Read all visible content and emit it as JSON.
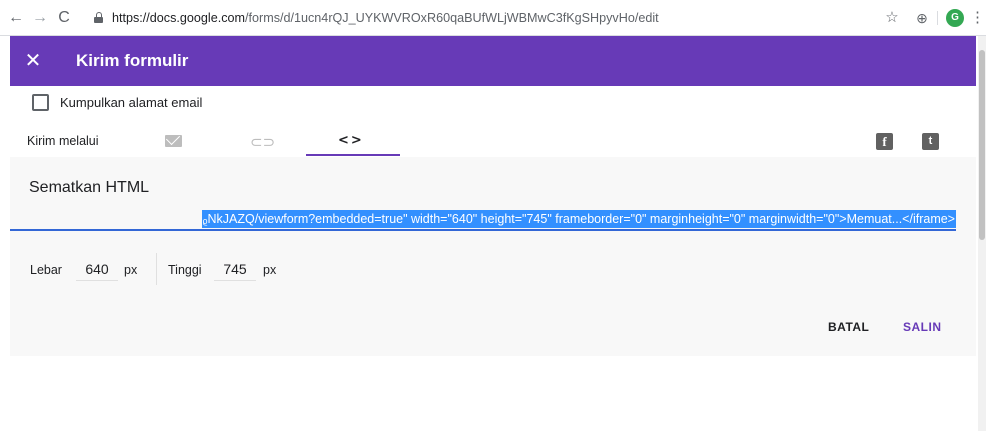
{
  "browser": {
    "url_host": "https://docs.google.com",
    "url_path": "/forms/d/1ucn4rQJ_UYKWVROxR60qaBUfWLjWBMwC3fKgSHpyvHo/edit",
    "nav_back": "←",
    "nav_forward": "→",
    "nav_reload": "C",
    "bookmark_star": "☆",
    "extension_glyph": "⊕",
    "avatar_initial": "G",
    "menu_dots": "⋮"
  },
  "dialog": {
    "close_glyph": "✕",
    "title": "Kirim formulir",
    "collect_email_label": "Kumpulkan alamat email",
    "collect_email_checked": false,
    "send_via_label": "Kirim melalui",
    "tabs": [
      {
        "name": "email",
        "icon": "mail-icon",
        "active": false
      },
      {
        "name": "link",
        "icon": "link-icon",
        "glyph": "⊂⊃",
        "active": false
      },
      {
        "name": "embed",
        "icon": "code-icon",
        "glyph": "<>",
        "active": true
      }
    ],
    "social": {
      "facebook_glyph": "f",
      "twitter_glyph": "t"
    },
    "embed": {
      "section_title": "Sematkan HTML",
      "code_visible": "ᵨNkJAZQ/viewform?embedded=true\" width=\"640\" height=\"745\" frameborder=\"0\" marginheight=\"0\" marginwidth=\"0\">Memuat...</iframe>",
      "width_label": "Lebar",
      "width_value": "640",
      "width_unit": "px",
      "height_label": "Tinggi",
      "height_value": "745",
      "height_unit": "px"
    },
    "buttons": {
      "cancel": "BATAL",
      "copy": "SALIN"
    }
  },
  "colors": {
    "header_purple": "#673ab7",
    "selection_blue": "#3390ff",
    "copy_button": "#673ab7"
  }
}
